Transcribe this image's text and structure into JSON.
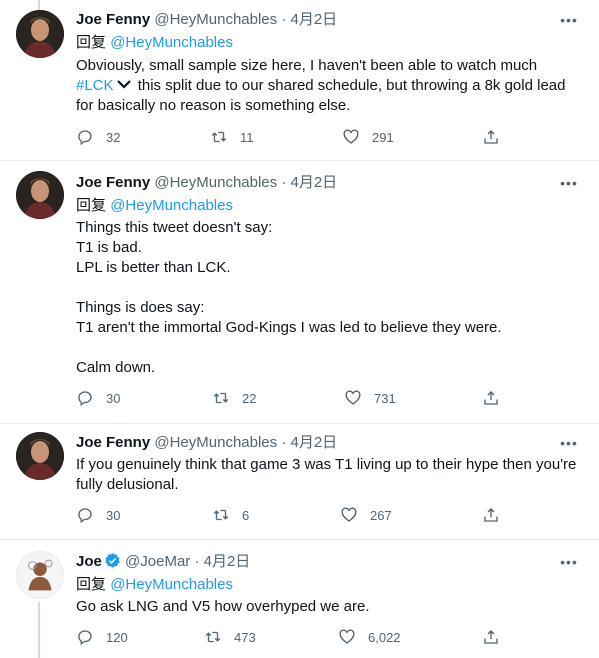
{
  "tweets": [
    {
      "name": "Joe Fenny",
      "handle": "@HeyMunchables",
      "dot": "·",
      "date": "4月2日",
      "reply_prefix": "回复",
      "reply_mention": "@HeyMunchables",
      "lines": [
        "Obviously, small sample size here, I haven't been able to watch much",
        "#LCK",
        "this split due to our shared schedule, but throwing a 8k gold lead",
        "for basically no reason is something else."
      ],
      "replies": "32",
      "retweets": "11",
      "likes": "291"
    },
    {
      "name": "Joe Fenny",
      "handle": "@HeyMunchables",
      "dot": "·",
      "date": "4月2日",
      "reply_prefix": "回复",
      "reply_mention": "@HeyMunchables",
      "lines": [
        "Things this tweet doesn't say:",
        "T1 is bad.",
        "LPL is better than LCK.",
        "Things is does say:",
        "T1 aren't the immortal God-Kings I was led to believe they were.",
        "Calm down."
      ],
      "replies": "30",
      "retweets": "22",
      "likes": "731"
    },
    {
      "name": "Joe Fenny",
      "handle": "@HeyMunchables",
      "dot": "·",
      "date": "4月2日",
      "lines": [
        "If you genuinely think that game 3 was T1 living up to their hype then you're",
        "fully delusional."
      ],
      "replies": "30",
      "retweets": "6",
      "likes": "267"
    },
    {
      "name": "Joe",
      "handle": "@JoeMar",
      "dot": "·",
      "date": "4月2日",
      "reply_prefix": "回复",
      "reply_mention": "@HeyMunchables",
      "lines": [
        "Go ask LNG and V5 how overhyped we are."
      ],
      "replies": "120",
      "retweets": "473",
      "likes": "6,022"
    }
  ],
  "icons": {
    "more": "more-icon",
    "reply": "reply-icon",
    "retweet": "retweet-icon",
    "like": "like-icon",
    "share": "share-icon",
    "verified": "verified-badge-icon"
  },
  "colors": {
    "link": "#1d9bf0",
    "secondary": "#536471",
    "divider": "#e6ecf0"
  }
}
